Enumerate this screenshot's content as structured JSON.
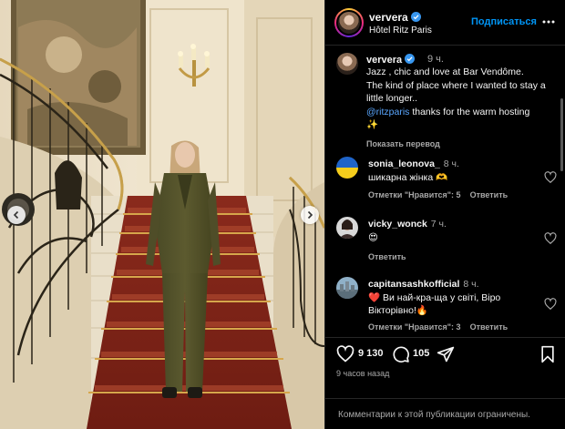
{
  "post": {
    "username": "ververa",
    "location": "Hôtel Ritz Paris",
    "follow_label": "Подписаться",
    "caption_time": "9 ч.",
    "caption": "Jazz , chic and love at Bar Vendôme.\nThe kind of place where I wanted to stay a little longer..",
    "mention": "@ritzparis",
    "caption_tail": " thanks for the warm hosting",
    "caption_emoji": "✨",
    "translate_label": "Показать перевод"
  },
  "comments": [
    {
      "user": "sonia_leonova_",
      "time": "8 ч.",
      "text": "шикарна жінка 🫶",
      "likes_label": "Отметки \"Нравится\": 5",
      "reply_label": "Ответить",
      "avatar": "ukraine-flag"
    },
    {
      "user": "vicky_wonck",
      "time": "7 ч.",
      "text": "😍",
      "likes_label": "",
      "reply_label": "Ответить",
      "avatar": "woman-photo"
    },
    {
      "user": "capitansashkofficial",
      "time": "8 ч.",
      "text": "❤️ Ви най-кра-ща у світі, Віро Вікторівно!🔥",
      "likes_label": "Отметки \"Нравится\": 3",
      "reply_label": "Ответить",
      "avatar": "city-photo"
    }
  ],
  "actions": {
    "likes": "9 130",
    "comments": "105",
    "posted_ago": "9 часов назад"
  },
  "footer": {
    "text": "Комментарии к этой публикации ограничены."
  },
  "colors": {
    "accent": "#0095f6",
    "verified": "#3897f0",
    "panel_bg": "#000000",
    "muted": "#a8a8a8"
  }
}
